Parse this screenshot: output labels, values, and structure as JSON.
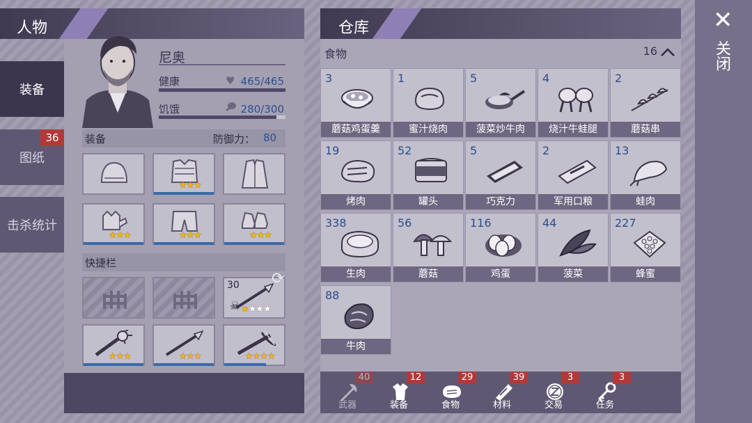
{
  "character": {
    "panel_title": "人物",
    "tabs": [
      {
        "label": "装备"
      },
      {
        "label": "图纸",
        "badge": "36"
      },
      {
        "label": "击杀统计"
      }
    ],
    "name": "尼奥",
    "health": {
      "label": "健康",
      "value": "465/465"
    },
    "hunger": {
      "label": "饥饿",
      "value": "280/300"
    },
    "equipment": {
      "label": "装备",
      "defense": "防御力：",
      "defense_value": "80",
      "slots": [
        {
          "icon": "helmet-icon",
          "stars": 0
        },
        {
          "icon": "body-armor-icon",
          "stars": 3
        },
        {
          "icon": "jacket-icon",
          "stars": 0
        },
        {
          "icon": "gloves-icon",
          "stars": 3
        },
        {
          "icon": "shorts-icon",
          "stars": 3
        },
        {
          "icon": "shoes-icon",
          "stars": 3
        }
      ]
    },
    "quickbar": {
      "label": "快捷栏",
      "slots": [
        {
          "locked": true
        },
        {
          "locked": true
        },
        {
          "count": "30",
          "icon": "spear-icon",
          "stars": 1,
          "empty_stars": 3
        },
        {
          "icon": "spiked-club-icon",
          "stars": 3
        },
        {
          "icon": "spear-icon",
          "stars": 3
        },
        {
          "icon": "crossbow-icon",
          "stars": 4
        }
      ]
    }
  },
  "warehouse": {
    "title": "仓库",
    "category": {
      "name": "食物",
      "count": "16"
    },
    "items": [
      {
        "qty": "3",
        "name": "蘑菇鸡蛋羹",
        "icon": "soup-bowl-icon"
      },
      {
        "qty": "1",
        "name": "蜜汁烧肉",
        "icon": "roast-meat-icon"
      },
      {
        "qty": "5",
        "name": "菠菜炒牛肉",
        "icon": "frying-pan-icon"
      },
      {
        "qty": "4",
        "name": "烧汁牛蛙腿",
        "icon": "frog-legs-icon"
      },
      {
        "qty": "2",
        "name": "蘑菇串",
        "icon": "mushroom-skewer-icon"
      },
      {
        "qty": "19",
        "name": "烤肉",
        "icon": "grilled-meat-icon"
      },
      {
        "qty": "52",
        "name": "罐头",
        "icon": "can-icon"
      },
      {
        "qty": "5",
        "name": "巧克力",
        "icon": "chocolate-bar-icon"
      },
      {
        "qty": "2",
        "name": "军用口粮",
        "icon": "ration-icon"
      },
      {
        "qty": "13",
        "name": "蛙肉",
        "icon": "frog-meat-icon"
      },
      {
        "qty": "338",
        "name": "生肉",
        "icon": "raw-meat-icon"
      },
      {
        "qty": "56",
        "name": "蘑菇",
        "icon": "mushroom-icon"
      },
      {
        "qty": "116",
        "name": "鸡蛋",
        "icon": "eggs-icon"
      },
      {
        "qty": "44",
        "name": "菠菜",
        "icon": "spinach-icon"
      },
      {
        "qty": "227",
        "name": "蜂蜜",
        "icon": "honeycomb-icon"
      },
      {
        "qty": "88",
        "name": "牛肉",
        "icon": "beef-icon"
      }
    ],
    "tabs": [
      {
        "label": "武器",
        "badge": "40",
        "icon": "axe-icon",
        "dim": true
      },
      {
        "label": "装备",
        "badge": "12",
        "icon": "shirt-icon"
      },
      {
        "label": "食物",
        "badge": "29",
        "icon": "meat-icon"
      },
      {
        "label": "材料",
        "badge": "39",
        "icon": "material-icon"
      },
      {
        "label": "交易",
        "badge": "3",
        "icon": "coin-icon"
      },
      {
        "label": "任务",
        "badge": "3",
        "icon": "key-icon"
      }
    ]
  },
  "close": {
    "icon": "close-icon",
    "label": "关闭"
  },
  "colors": {
    "accent": "#8e80b4",
    "badge": "#b03a3a",
    "quantity": "#2b4d86",
    "star": "#f3b418"
  }
}
